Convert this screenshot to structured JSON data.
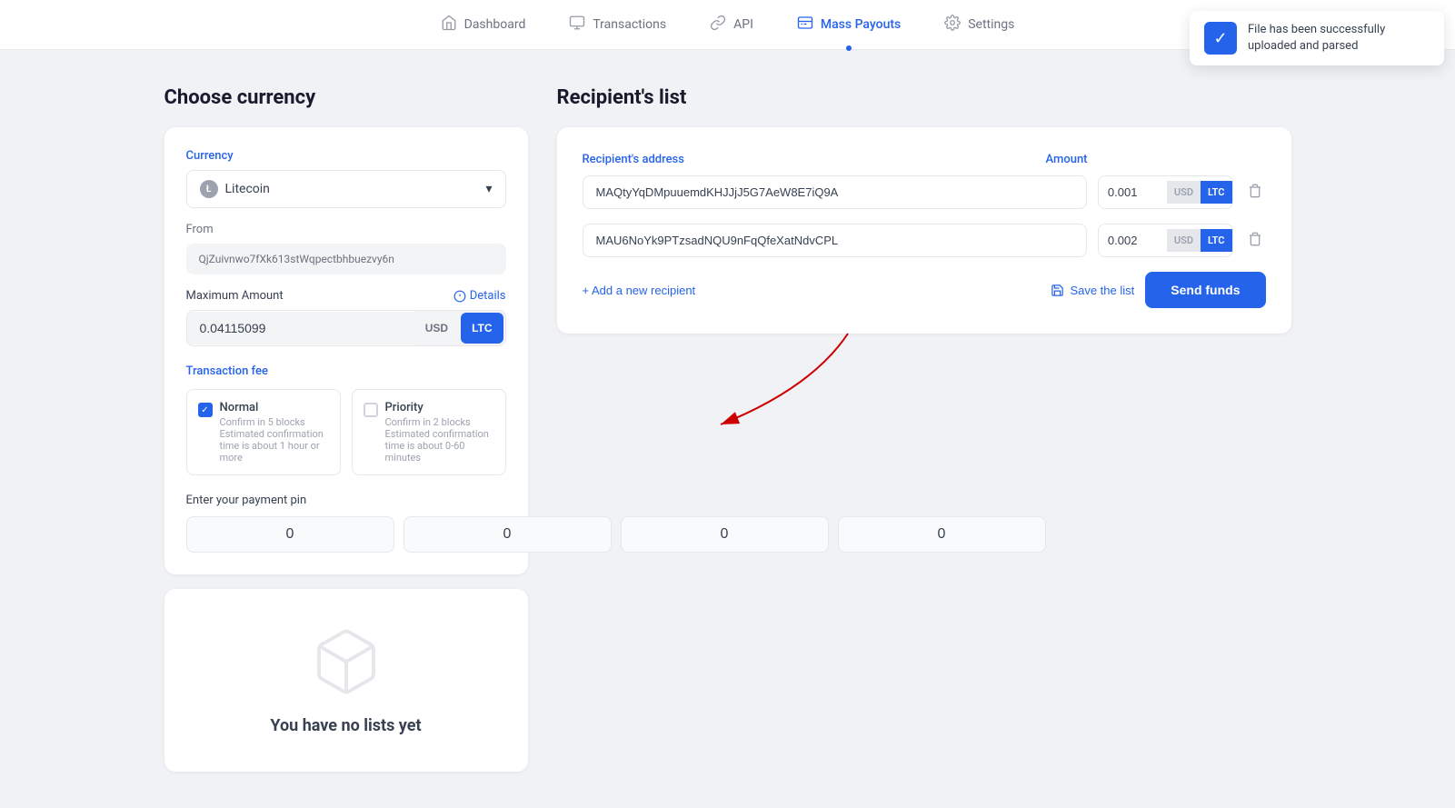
{
  "nav": {
    "items": [
      {
        "id": "dashboard",
        "label": "Dashboard",
        "icon": "🏠",
        "active": false
      },
      {
        "id": "transactions",
        "label": "Transactions",
        "icon": "📋",
        "active": false
      },
      {
        "id": "api",
        "label": "API",
        "icon": "🔗",
        "active": false
      },
      {
        "id": "mass-payouts",
        "label": "Mass Payouts",
        "icon": "💸",
        "active": true
      },
      {
        "id": "settings",
        "label": "Settings",
        "icon": "⚙️",
        "active": false
      }
    ]
  },
  "toast": {
    "message": "File has been successfully uploaded and parsed"
  },
  "left": {
    "title": "Choose currency",
    "currency_label": "Currency",
    "currency_value": "Litecoin",
    "from_label": "From",
    "from_address": "QjZuivnwo7fXk613stWqpectbhbuezvy6n",
    "max_amount_label": "Maximum Amount",
    "details_label": "Details",
    "max_amount_value": "0.04115099",
    "usd_btn": "USD",
    "ltc_btn": "LTC",
    "tx_fee_label": "Transaction fee",
    "normal_title": "Normal",
    "normal_desc": "Confirm in 5 blocks\nEstimated confirmation time is about 1 hour or more",
    "priority_title": "Priority",
    "priority_desc": "Confirm in 2 blocks\nEstimated confirmation time is about 0-60 minutes",
    "pin_label": "Enter your payment pin",
    "pin_values": [
      "0",
      "0",
      "0",
      "0"
    ]
  },
  "no_lists": {
    "text": "You have no lists yet"
  },
  "right": {
    "title": "Recipient's list",
    "address_label": "Recipient's address",
    "amount_label": "Amount",
    "recipients": [
      {
        "address": "MAQtyYqDMpuuemdKHJJjJ5G7AeW8E7iQ9A",
        "amount": "0.001",
        "currency": "LTC"
      },
      {
        "address": "MAU6NoYk9PTzsadNQU9nFqQfeXatNdvCPL",
        "amount": "0.002",
        "currency": "LTC"
      }
    ],
    "add_recipient_label": "+ Add a new recipient",
    "save_list_label": "Save the list",
    "send_funds_label": "Send funds"
  }
}
